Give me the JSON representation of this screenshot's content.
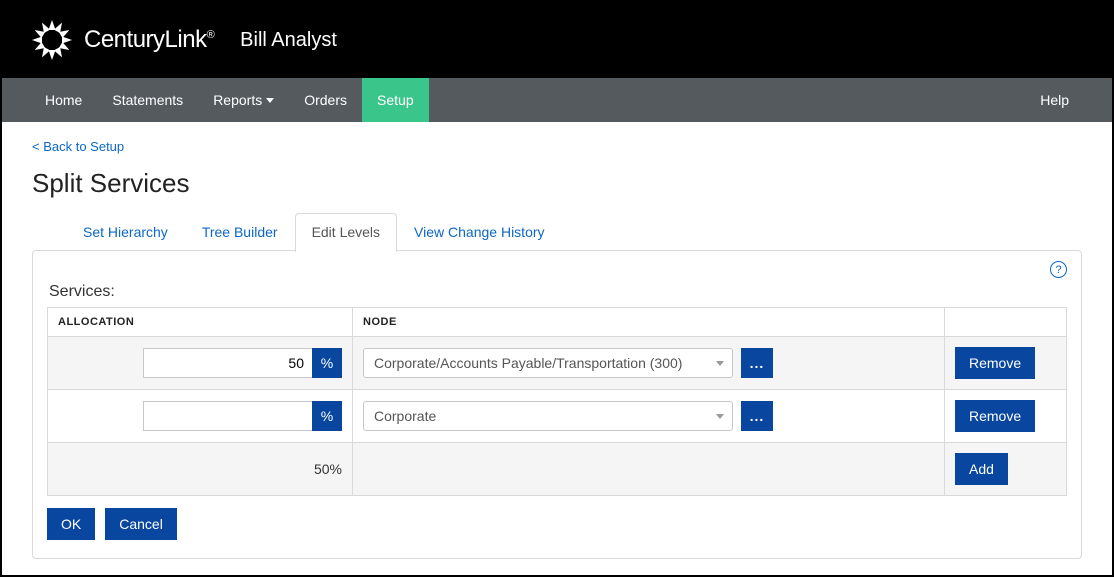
{
  "header": {
    "brand": "CenturyLink",
    "app": "Bill Analyst"
  },
  "nav": {
    "items": [
      "Home",
      "Statements",
      "Reports",
      "Orders",
      "Setup"
    ],
    "active_index": 4,
    "dropdown_indices": [
      2
    ],
    "help": "Help"
  },
  "page": {
    "back_link": "< Back to Setup",
    "title": "Split Services"
  },
  "tabs": {
    "items": [
      "Set Hierarchy",
      "Tree Builder",
      "Edit Levels",
      "View Change History"
    ],
    "active_index": 2
  },
  "panel": {
    "help_tooltip": "?",
    "services_label": "Services:",
    "columns": {
      "allocation": "ALLOCATION",
      "node": "NODE"
    },
    "percent_symbol": "%",
    "more_label": "...",
    "rows": [
      {
        "allocation": "50",
        "node": "Corporate/Accounts Payable/Transportation (300)",
        "action": "Remove"
      },
      {
        "allocation": "",
        "node": "Corporate",
        "action": "Remove"
      }
    ],
    "total_allocation": "50%",
    "add_label": "Add",
    "ok_label": "OK",
    "cancel_label": "Cancel"
  }
}
